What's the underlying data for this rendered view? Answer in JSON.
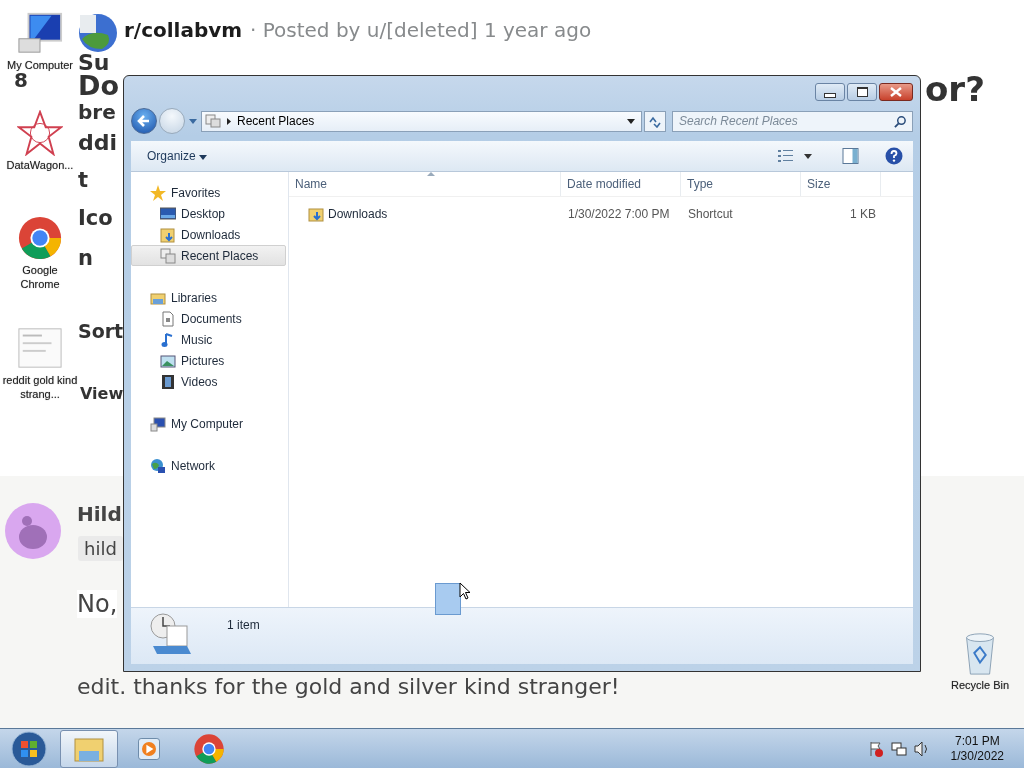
{
  "wallpaper": {
    "subreddit": "r/collabvm",
    "post_meta": "· Posted by u/[deleted] 1 year ago",
    "fragments": [
      {
        "text": "Su"
      },
      {
        "text": "8"
      },
      {
        "text": "Do"
      },
      {
        "text": "bre"
      },
      {
        "text": "ddi"
      },
      {
        "text": "t"
      },
      {
        "text": "Ico"
      },
      {
        "text": "n"
      },
      {
        "text": "Sort"
      },
      {
        "text": "View"
      },
      {
        "text": "or?"
      }
    ],
    "comment": {
      "author": "Hild",
      "flair": "hild",
      "body": "No,",
      "edit": "edit. thanks for the gold and silver kind stranger!"
    }
  },
  "desktop_icons": [
    {
      "label": "My Computer"
    },
    {
      "label": "DataWagon..."
    },
    {
      "label": "Google Chrome"
    },
    {
      "label": "reddit gold kind strang..."
    },
    {
      "label": "Recycle Bin"
    }
  ],
  "explorer": {
    "address": "Recent Places",
    "search": {
      "placeholder": "Search Recent Places"
    },
    "toolbar": {
      "organize": "Organize"
    },
    "nav": [
      {
        "label": "Favorites",
        "selected": false,
        "children": [
          {
            "label": "Desktop",
            "selected": false
          },
          {
            "label": "Downloads",
            "selected": false
          },
          {
            "label": "Recent Places",
            "selected": true
          }
        ]
      },
      {
        "label": "Libraries",
        "selected": false,
        "children": [
          {
            "label": "Documents",
            "selected": false
          },
          {
            "label": "Music",
            "selected": false
          },
          {
            "label": "Pictures",
            "selected": false
          },
          {
            "label": "Videos",
            "selected": false
          }
        ]
      },
      {
        "label": "My Computer",
        "selected": false
      },
      {
        "label": "Network",
        "selected": false
      }
    ],
    "columns": [
      "Name",
      "Date modified",
      "Type",
      "Size"
    ],
    "rows": [
      {
        "name": "Downloads",
        "date_modified": "1/30/2022 7:00 PM",
        "type": "Shortcut",
        "size": "1 KB",
        "selected": false
      }
    ],
    "status": "1 item"
  },
  "taskbar": {
    "apps": [
      {
        "kind": "explorer",
        "active": true
      },
      {
        "kind": "media",
        "active": false
      },
      {
        "kind": "chrome",
        "active": false
      }
    ],
    "time": "7:01 PM",
    "date": "1/30/2022"
  }
}
